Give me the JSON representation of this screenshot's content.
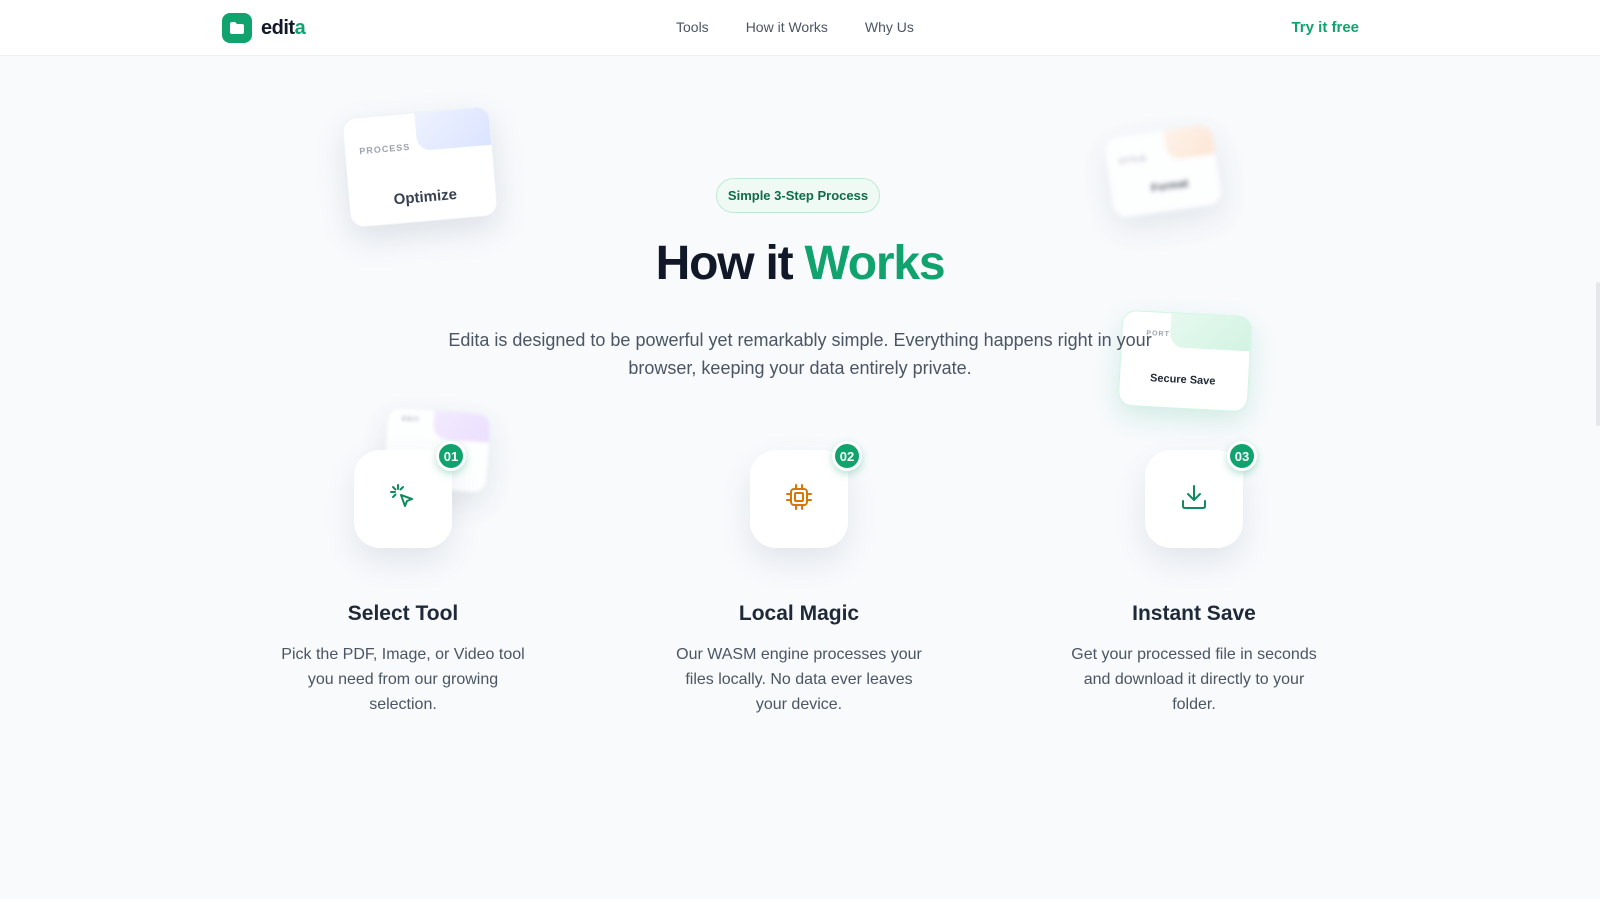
{
  "nav": {
    "logo_prefix": "edit",
    "logo_accent": "a",
    "links": [
      "Tools",
      "How it Works",
      "Why Us"
    ],
    "cta": "Try it free"
  },
  "floating_cards": {
    "optimize": {
      "kicker": "PROCESS",
      "title": "Optimize"
    },
    "format": {
      "kicker": "STYLE",
      "title": "Format"
    },
    "secure": {
      "kicker": "PORT",
      "title": "Secure Save"
    },
    "edit": {
      "kicker": "EDIT"
    }
  },
  "hero": {
    "badge": "Simple 3-Step Process",
    "heading_main": "How it ",
    "heading_accent": "Works",
    "lead": "Edita is designed to be powerful yet remarkably simple. Everything happens right in your browser, keeping your data entirely private."
  },
  "steps": [
    {
      "number": "01",
      "icon": "cursor-click-icon",
      "title": "Select Tool",
      "description": "Pick the PDF, Image, or Video tool you need from our growing selection."
    },
    {
      "number": "02",
      "icon": "cpu-chip-icon",
      "title": "Local Magic",
      "description": "Our WASM engine processes your files locally. No data ever leaves your device."
    },
    {
      "number": "03",
      "icon": "download-icon",
      "title": "Instant Save",
      "description": "Get your processed file in seconds and download it directly to your folder."
    }
  ],
  "colors": {
    "brand": "#10a36e",
    "heading": "#111827",
    "body": "#4b5563",
    "chip": "#d97706",
    "background": "#f8fafc"
  }
}
